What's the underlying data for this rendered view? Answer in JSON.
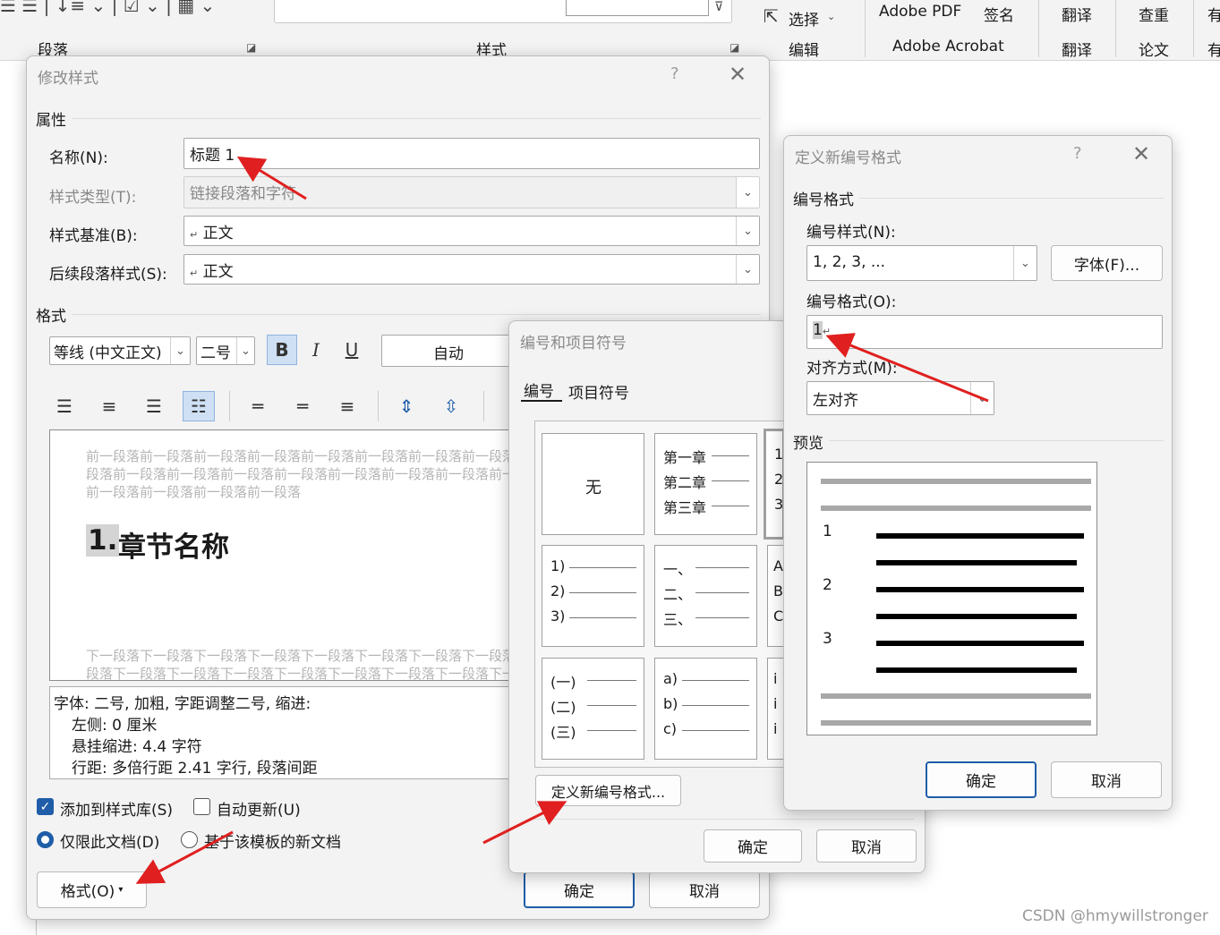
{
  "ribbon": {
    "paragraph_group": "段落",
    "styles_group": "样式",
    "select_label": "选择",
    "edit_label": "编辑",
    "adobe_pdf": "Adobe PDF",
    "adobe_acrobat": "Adobe Acrobat",
    "sign_label": "签名",
    "translate_top": "翻译",
    "translate_bottom": "翻译",
    "check_dup": "查重",
    "paper": "论文",
    "partial_top": "有",
    "partial_bottom": "有"
  },
  "modify_style": {
    "title": "修改样式",
    "help": "?",
    "properties_heading": "属性",
    "name_label": "名称(N):",
    "name_value": "标题 1",
    "style_type_label": "样式类型(T):",
    "style_type_value": "链接段落和字符",
    "style_based_label": "样式基准(B):",
    "style_based_value": "正文",
    "next_para_label": "后续段落样式(S):",
    "next_para_value": "正文",
    "format_heading": "格式",
    "font_name": "等线 (中文正文)",
    "font_size": "二号",
    "bold": "B",
    "italic": "I",
    "underline": "U",
    "color": "自动",
    "preview_prev_1": "前一段落前一段落前一段落前一段落前一段落前一段落前一段落前一段落",
    "preview_prev_2": "段落前一段落前一段落前一段落前一段落前一段落前一段落前一段落前一段",
    "preview_prev_3": "前一段落前一段落前一段落前一段落",
    "preview_heading_num": "1.",
    "preview_heading_text": "章节名称",
    "preview_next_1": "下一段落下一段落下一段落下一段落下一段落下一段落下一段落下一段落",
    "preview_next_2": "段落下一段落下一段落下一段落下一段落下一段落下一段落下一段落下一段",
    "desc_1": "字体: 二号, 加粗, 字距调整二号, 缩进:",
    "desc_2": "左侧:  0 厘米",
    "desc_3": "悬挂缩进: 4.4 字符",
    "desc_4": "行距: 多倍行距 2.41 字行, 段落间距",
    "add_gallery": "添加到样式库(S)",
    "auto_update": "自动更新(U)",
    "only_doc": "仅限此文档(D)",
    "new_template": "基于该模板的新文档",
    "format_button": "格式(O)",
    "ok": "确定",
    "cancel": "取消"
  },
  "numbering": {
    "title": "编号和项目符号",
    "tab_numbering": "编号",
    "tab_bullets": "项目符号",
    "none": "无",
    "chapter": [
      "第一章",
      "第二章",
      "第三章"
    ],
    "partial_arabic": [
      "1",
      "2",
      "3"
    ],
    "paren_arabic": [
      "1)",
      "2)",
      "3)"
    ],
    "chinese_comma": [
      "一、",
      "二、",
      "三、"
    ],
    "partial_alpha": [
      "A",
      "B",
      "C"
    ],
    "paren_chinese": [
      "(一)",
      "(二)",
      "(三)"
    ],
    "letters": [
      "a)",
      "b)",
      "c)"
    ],
    "partial_roman": [
      "i",
      "i",
      "i"
    ],
    "define_new": "定义新编号格式...",
    "ok": "确定",
    "cancel": "取消"
  },
  "define_format": {
    "title": "定义新编号格式",
    "help": "?",
    "group_heading": "编号格式",
    "style_label": "编号样式(N):",
    "style_value": "1, 2, 3, ...",
    "font_button": "字体(F)...",
    "format_label": "编号格式(O):",
    "format_value": "1",
    "align_label": "对齐方式(M):",
    "align_value": "左对齐",
    "preview_heading": "预览",
    "preview_numbers": [
      "1",
      "2",
      "3"
    ],
    "ok": "确定",
    "cancel": "取消"
  },
  "watermark": "CSDN @hmywillstronger",
  "colors": {
    "arrow": "#e02020",
    "accent": "#1f5da8"
  }
}
